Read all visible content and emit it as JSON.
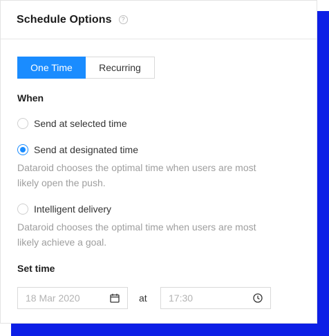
{
  "card": {
    "title": "Schedule Options",
    "help_icon": "question-circle-icon"
  },
  "tabs": [
    {
      "label": "One Time",
      "active": true
    },
    {
      "label": "Recurring",
      "active": false
    }
  ],
  "when": {
    "label": "When",
    "options": [
      {
        "label": "Send at selected time",
        "checked": false,
        "helper": ""
      },
      {
        "label": "Send at designated time",
        "checked": true,
        "helper": "Dataroid chooses the optimal time when users are most likely open the push."
      },
      {
        "label": "Intelligent delivery",
        "checked": false,
        "helper": "Dataroid chooses the optimal time when users are most likely achieve a goal."
      }
    ]
  },
  "set_time": {
    "label": "Set time",
    "date_placeholder": "18 Mar 2020",
    "date_icon": "calendar-icon",
    "at_label": "at",
    "time_placeholder": "17:30",
    "time_icon": "clock-icon"
  },
  "colors": {
    "accent": "#1a8cff",
    "backdrop": "#0d1fe6",
    "helper_text": "#9e9e9e"
  }
}
